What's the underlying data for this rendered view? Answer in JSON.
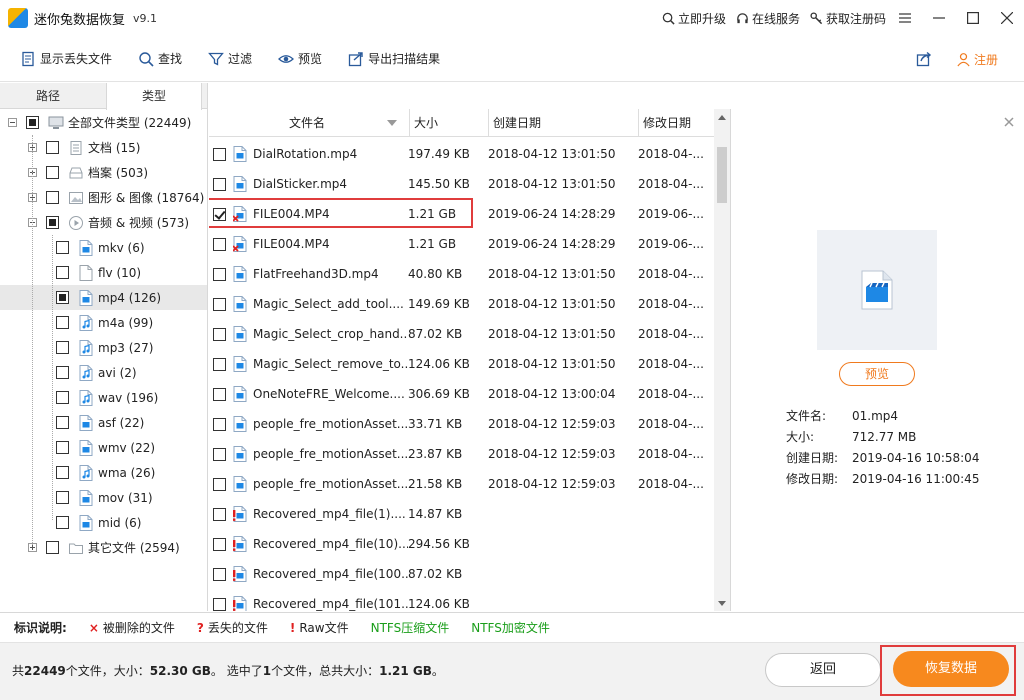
{
  "title_bar": {
    "app_title": "迷你兔数据恢复",
    "version": "v9.1",
    "actions": [
      {
        "label": "立即升级",
        "icon": "search-icon"
      },
      {
        "label": "在线服务",
        "icon": "headset-icon"
      },
      {
        "label": "获取注册码",
        "icon": "key-icon"
      }
    ]
  },
  "toolbar": {
    "items": [
      {
        "label": "显示丢失文件",
        "icon": "file-list-icon"
      },
      {
        "label": "查找",
        "icon": "search-icon"
      },
      {
        "label": "过滤",
        "icon": "filter-icon"
      },
      {
        "label": "预览",
        "icon": "eye-icon"
      },
      {
        "label": "导出扫描结果",
        "icon": "export-icon"
      }
    ],
    "register_label": "注册"
  },
  "left_panel": {
    "tabs": [
      {
        "label": "路径",
        "active": false
      },
      {
        "label": "类型",
        "active": true
      }
    ],
    "tree": [
      {
        "label": "全部文件类型 (22449)",
        "level": 0,
        "state": "partial",
        "expander": "minus",
        "icon": "computer-icon"
      },
      {
        "label": "文档 (15)",
        "level": 1,
        "state": "none",
        "expander": "plus",
        "icon": "document-icon"
      },
      {
        "label": "档案 (503)",
        "level": 1,
        "state": "none",
        "expander": "plus",
        "icon": "archive-icon"
      },
      {
        "label": "图形 & 图像 (18764)",
        "level": 1,
        "state": "none",
        "expander": "plus",
        "icon": "image-icon"
      },
      {
        "label": "音频 & 视频 (573)",
        "level": 1,
        "state": "partial",
        "expander": "minus",
        "icon": "media-icon"
      },
      {
        "label": "mkv (6)",
        "level": 2,
        "state": "none",
        "icon": "video-file-icon"
      },
      {
        "label": "flv (10)",
        "level": 2,
        "state": "none",
        "icon": "blank-file-icon"
      },
      {
        "label": "mp4 (126)",
        "level": 2,
        "state": "partial",
        "icon": "video-file-icon",
        "selected": true
      },
      {
        "label": "m4a (99)",
        "level": 2,
        "state": "none",
        "icon": "audio-file-icon"
      },
      {
        "label": "mp3 (27)",
        "level": 2,
        "state": "none",
        "icon": "audio-file-icon"
      },
      {
        "label": "avi (2)",
        "level": 2,
        "state": "none",
        "icon": "audio-file-icon"
      },
      {
        "label": "wav (196)",
        "level": 2,
        "state": "none",
        "icon": "audio-file-icon"
      },
      {
        "label": "asf (22)",
        "level": 2,
        "state": "none",
        "icon": "video-file-icon"
      },
      {
        "label": "wmv (22)",
        "level": 2,
        "state": "none",
        "icon": "video-file-icon"
      },
      {
        "label": "wma (26)",
        "level": 2,
        "state": "none",
        "icon": "audio-file-icon"
      },
      {
        "label": "mov (31)",
        "level": 2,
        "state": "none",
        "icon": "video-file-icon"
      },
      {
        "label": "mid (6)",
        "level": 2,
        "state": "none",
        "icon": "video-file-icon"
      },
      {
        "label": "其它文件 (2594)",
        "level": 1,
        "state": "none",
        "expander": "plus",
        "icon": "folder-icon"
      }
    ]
  },
  "file_list": {
    "columns": [
      "文件名",
      "大小",
      "创建日期",
      "修改日期"
    ],
    "rows": [
      {
        "name": "DialRotation.mp4",
        "size": "197.49 KB",
        "created": "2018-04-12 13:01:50",
        "modified": "2018-04-...",
        "checked": false,
        "mark": "none"
      },
      {
        "name": "DialSticker.mp4",
        "size": "145.50 KB",
        "created": "2018-04-12 13:01:50",
        "modified": "2018-04-...",
        "checked": false,
        "mark": "none"
      },
      {
        "name": "FILE004.MP4",
        "size": "1.21 GB",
        "created": "2019-06-24 14:28:29",
        "modified": "2019-06-...",
        "checked": true,
        "mark": "deleted"
      },
      {
        "name": "FILE004.MP4",
        "size": "1.21 GB",
        "created": "2019-06-24 14:28:29",
        "modified": "2019-06-...",
        "checked": false,
        "mark": "deleted"
      },
      {
        "name": "FlatFreehand3D.mp4",
        "size": "40.80 KB",
        "created": "2018-04-12 13:01:50",
        "modified": "2018-04-...",
        "checked": false,
        "mark": "none"
      },
      {
        "name": "Magic_Select_add_tool....",
        "size": "149.69 KB",
        "created": "2018-04-12 13:01:50",
        "modified": "2018-04-...",
        "checked": false,
        "mark": "none"
      },
      {
        "name": "Magic_Select_crop_hand...",
        "size": "87.02 KB",
        "created": "2018-04-12 13:01:50",
        "modified": "2018-04-...",
        "checked": false,
        "mark": "none"
      },
      {
        "name": "Magic_Select_remove_to...",
        "size": "124.06 KB",
        "created": "2018-04-12 13:01:50",
        "modified": "2018-04-...",
        "checked": false,
        "mark": "none"
      },
      {
        "name": "OneNoteFRE_Welcome....",
        "size": "306.69 KB",
        "created": "2018-04-12 13:00:04",
        "modified": "2018-04-...",
        "checked": false,
        "mark": "none"
      },
      {
        "name": "people_fre_motionAsset...",
        "size": "33.71 KB",
        "created": "2018-04-12 12:59:03",
        "modified": "2018-04-...",
        "checked": false,
        "mark": "none"
      },
      {
        "name": "people_fre_motionAsset...",
        "size": "23.87 KB",
        "created": "2018-04-12 12:59:03",
        "modified": "2018-04-...",
        "checked": false,
        "mark": "none"
      },
      {
        "name": "people_fre_motionAsset...",
        "size": "21.58 KB",
        "created": "2018-04-12 12:59:03",
        "modified": "2018-04-...",
        "checked": false,
        "mark": "none"
      },
      {
        "name": "Recovered_mp4_file(1)....",
        "size": "14.87 KB",
        "created": "",
        "modified": "",
        "checked": false,
        "mark": "raw"
      },
      {
        "name": "Recovered_mp4_file(10)....",
        "size": "294.56 KB",
        "created": "",
        "modified": "",
        "checked": false,
        "mark": "raw"
      },
      {
        "name": "Recovered_mp4_file(100...",
        "size": "87.02 KB",
        "created": "",
        "modified": "",
        "checked": false,
        "mark": "raw"
      },
      {
        "name": "Recovered_mp4_file(101...",
        "size": "124.06 KB",
        "created": "",
        "modified": "",
        "checked": false,
        "mark": "raw"
      }
    ]
  },
  "preview_panel": {
    "preview_button": "预览",
    "info": [
      {
        "key": "文件名:",
        "value": "01.mp4"
      },
      {
        "key": "大小:",
        "value": "712.77 MB"
      },
      {
        "key": "创建日期:",
        "value": "2019-04-16 10:58:04"
      },
      {
        "key": "修改日期:",
        "value": "2019-04-16 11:00:45"
      }
    ]
  },
  "legend": {
    "title": "标识说明:",
    "items": [
      {
        "mark": "×",
        "label": "被删除的文件",
        "color": "#e02020"
      },
      {
        "mark": "?",
        "label": "丢失的文件",
        "color": "#e02020"
      },
      {
        "mark": "!",
        "label": "Raw文件",
        "color": "#e02020"
      },
      {
        "mark": "",
        "label": "NTFS压缩文件",
        "color": "#1a9e1a"
      },
      {
        "mark": "",
        "label": "NTFS加密文件",
        "color": "#1a9e1a"
      }
    ]
  },
  "status_bar": {
    "prefix": "共",
    "total_files": "22449",
    "files_unit_size": "个文件，大小：",
    "total_size": "52.30 GB",
    "mid": "。 选中了",
    "selected_count": "1",
    "selected_unit": "个文件，总共大小：",
    "selected_size": "1.21 GB",
    "suffix": "。",
    "back_button": "返回",
    "recover_button": "恢复数据"
  },
  "colors": {
    "accent": "#f7891e",
    "highlight_border": "#e03c3c",
    "file_icon_blue": "#1e88e5"
  }
}
